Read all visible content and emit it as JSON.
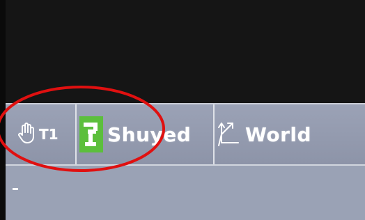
{
  "status_bar": {
    "jog_mode": {
      "icon": "hand-icon",
      "label": "T1"
    },
    "robot": {
      "icon": "robot-arm-icon",
      "label": "Shuyed"
    },
    "coordinate_system": {
      "icon": "coordinate-axes-icon",
      "label": "World"
    }
  },
  "colors": {
    "screen_background": "#151515",
    "status_bar_background": "#959cb0",
    "robot_icon_background": "#5cbf3c",
    "annotation": "#e01010",
    "text": "#ffffff"
  }
}
